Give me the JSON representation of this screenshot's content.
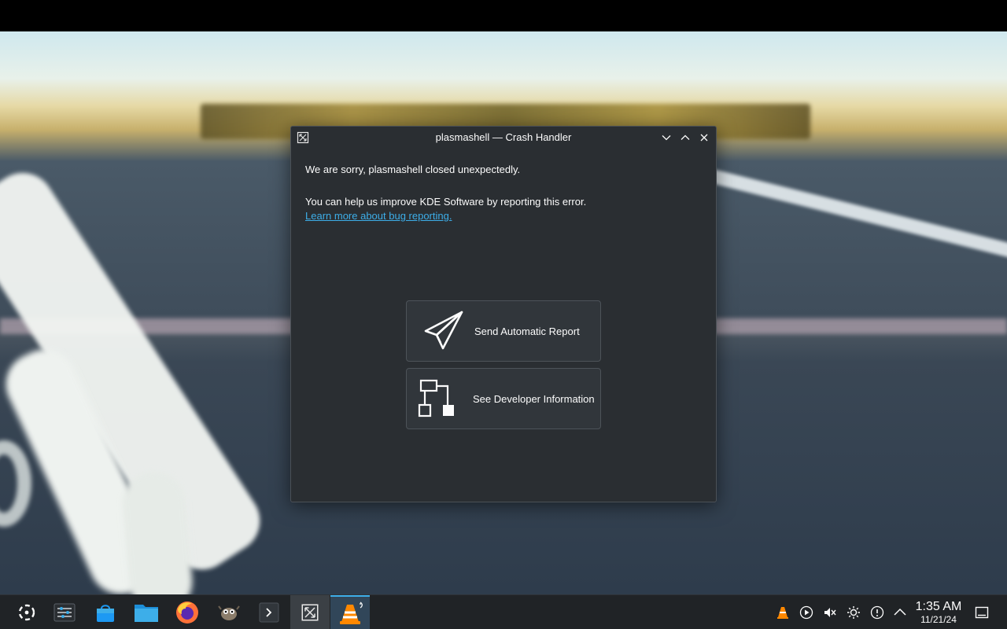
{
  "dialog": {
    "title": "plasmashell — Crash Handler",
    "message_sorry": "We are sorry, plasmashell closed unexpectedly.",
    "message_help": "You can help us improve KDE Software by reporting this error.",
    "link_label": "Learn more about bug reporting.",
    "send_report_label": "Send Automatic Report",
    "developer_info_label": "See Developer Information"
  },
  "taskbar": {
    "items": [
      {
        "icon": "application-launcher-icon"
      },
      {
        "icon": "system-settings-icon"
      },
      {
        "icon": "discover-store-icon"
      },
      {
        "icon": "dolphin-files-icon"
      },
      {
        "icon": "firefox-icon"
      },
      {
        "icon": "gimp-icon"
      },
      {
        "icon": "konsole-terminal-icon"
      },
      {
        "icon": "crash-handler-icon"
      },
      {
        "icon": "vlc-icon"
      }
    ],
    "tray": [
      "vlc-tray-icon",
      "media-player-icon",
      "volume-muted-icon",
      "brightness-icon",
      "updates-icon",
      "show-hidden-icon"
    ],
    "clock_time": "1:35 AM",
    "clock_date": "11/21/24"
  },
  "colors": {
    "link": "#3daee9",
    "window_bg": "#2a2e32",
    "button_bg": "#31363b",
    "taskbar_bg": "#202326"
  }
}
